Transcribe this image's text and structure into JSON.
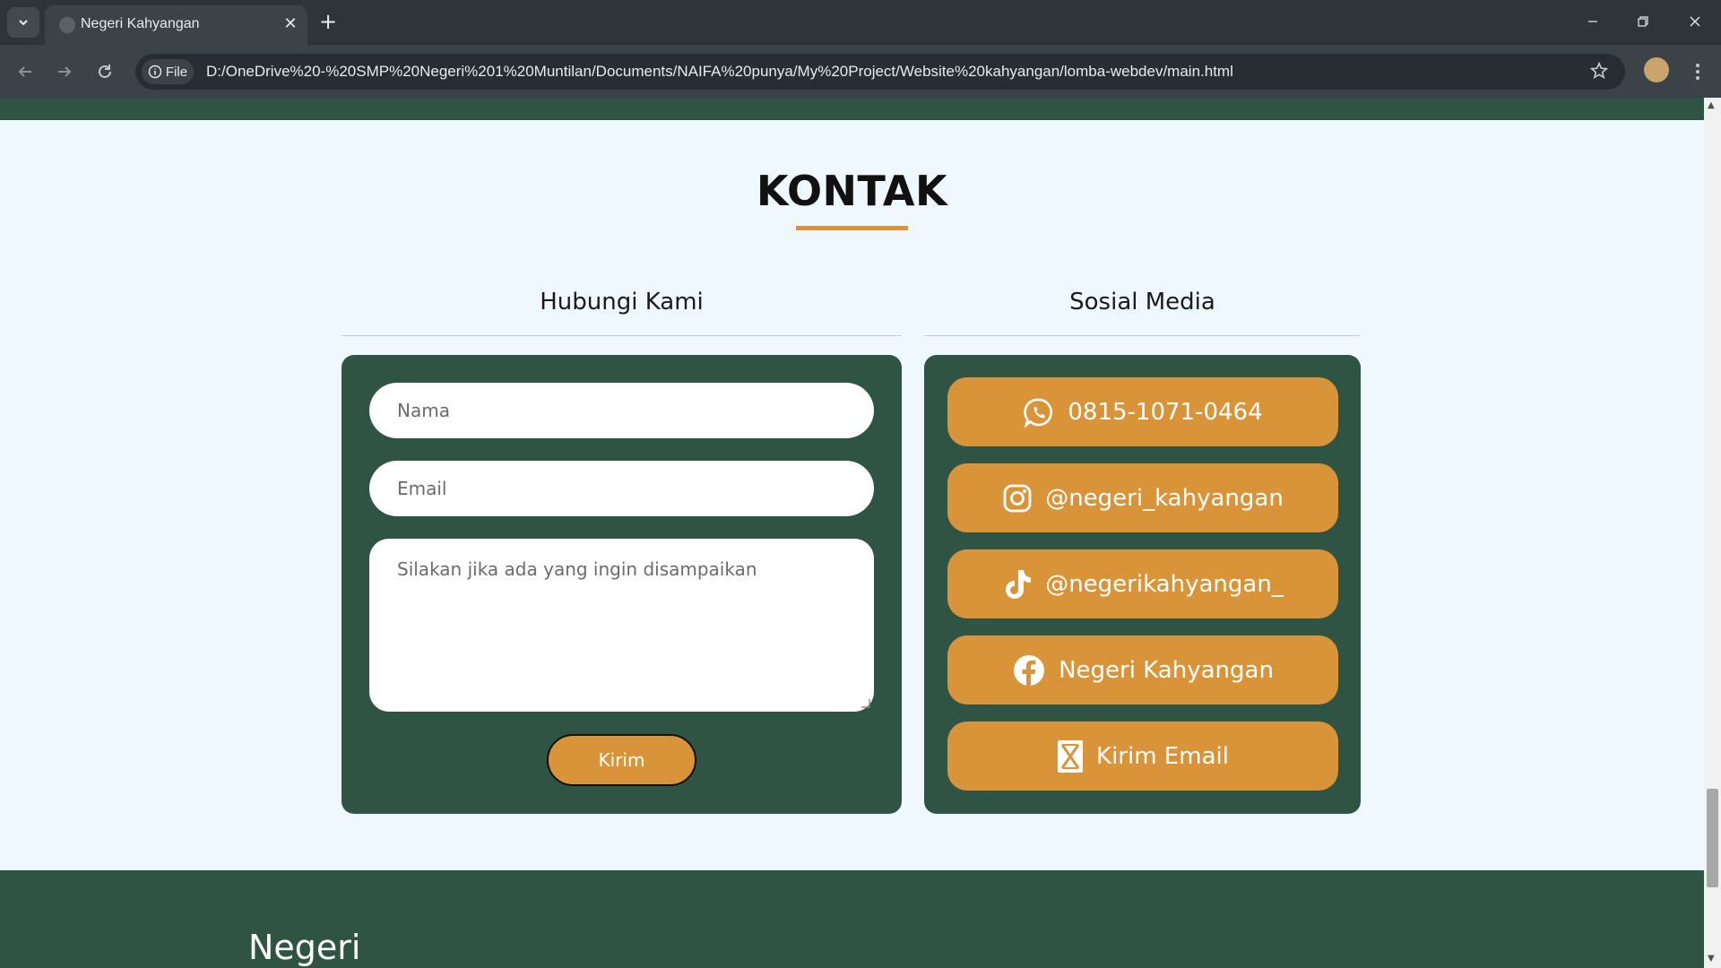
{
  "browser": {
    "tab_title": "Negeri Kahyangan",
    "tab_close": "✕",
    "new_tab": "+",
    "chip_label": "File",
    "url": "D:/OneDrive%20-%20SMP%20Negeri%201%20Muntilan/Documents/NAIFA%20punya/My%20Project/Website%20kahyangan/lomba-webdev/main.html"
  },
  "page": {
    "section_title": "KONTAK",
    "contact": {
      "heading": "Hubungi Kami",
      "name_placeholder": "Nama",
      "email_placeholder": "Email",
      "message_placeholder": "Silakan jika ada yang ingin disampaikan",
      "submit_label": "Kirim"
    },
    "social": {
      "heading": "Sosial Media",
      "items": [
        {
          "icon": "whatsapp-icon",
          "label": "0815-1071-0464"
        },
        {
          "icon": "instagram-icon",
          "label": "@negeri_kahyangan"
        },
        {
          "icon": "tiktok-icon",
          "label": "@negerikahyangan_"
        },
        {
          "icon": "facebook-icon",
          "label": "Negeri Kahyangan"
        },
        {
          "icon": "email-icon",
          "label": "Kirim Email"
        }
      ]
    },
    "footer_title": "Negeri"
  },
  "colors": {
    "green": "#2f5443",
    "accent": "#d99439",
    "background": "#f0f8ff"
  }
}
